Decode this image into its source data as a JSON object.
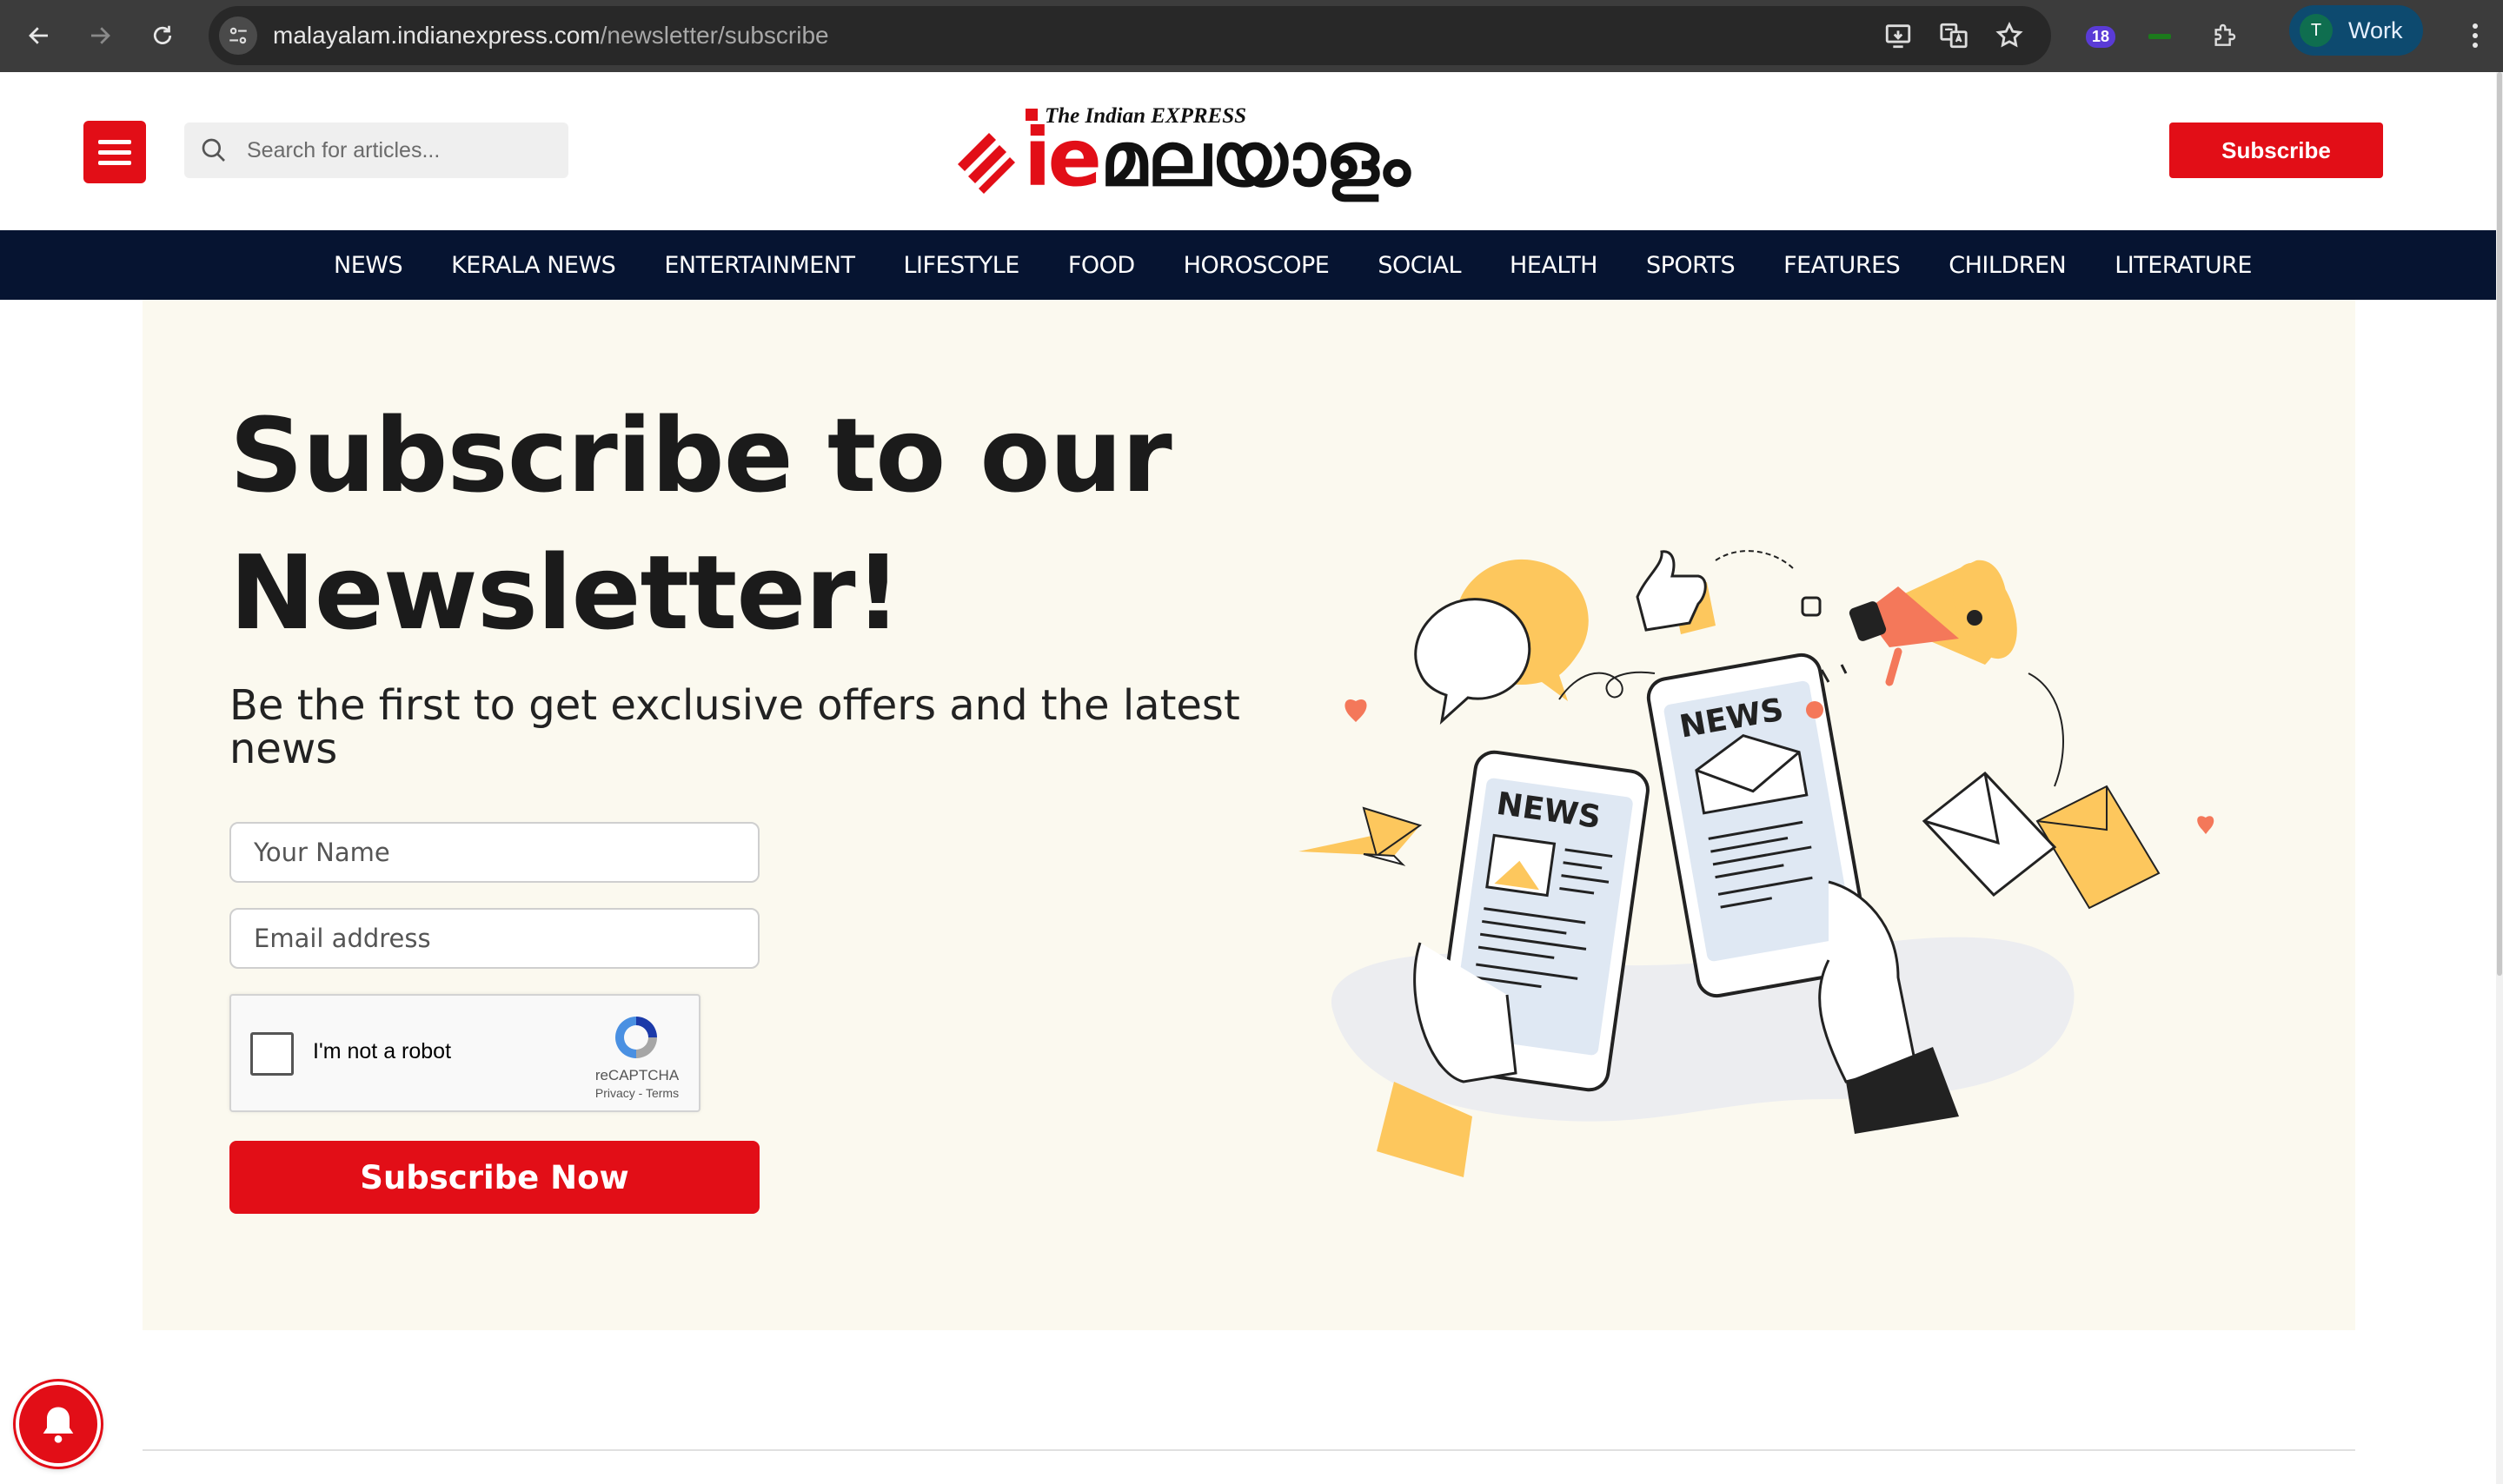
{
  "browser": {
    "url_host": "malayalam.indianexpress.com",
    "url_path": "/newsletter/subscribe",
    "extension_badge": "18",
    "profile_initial": "T",
    "profile_label": "Work"
  },
  "header": {
    "search_placeholder": "Search for articles...",
    "logo_top_text": "The Indian EXPRESS",
    "logo_mark": "ie",
    "logo_script": "മലയാളം",
    "subscribe_label": "Subscribe"
  },
  "nav": {
    "items": [
      "NEWS",
      "KERALA NEWS",
      "ENTERTAINMENT",
      "LIFESTYLE",
      "FOOD",
      "HOROSCOPE",
      "SOCIAL",
      "HEALTH",
      "SPORTS",
      "FEATURES",
      "CHILDREN",
      "LITERATURE"
    ]
  },
  "hero": {
    "title": "Subscribe to our Newsletter!",
    "subtitle": "Be the first to get exclusive offers and the latest news",
    "name_placeholder": "Your Name",
    "email_placeholder": "Email address",
    "captcha_label": "I'm not a robot",
    "captcha_brand": "reCAPTCHA",
    "captcha_links": "Privacy - Terms",
    "submit_label": "Subscribe Now",
    "illustration_news_left": "NEWS",
    "illustration_news_right": "NEWS"
  },
  "colors": {
    "brand_red": "#e20e17",
    "nav_navy": "#061431",
    "hero_bg": "#fbf9ef",
    "accent_yellow": "#fdc75d",
    "accent_orange": "#f4785a"
  }
}
